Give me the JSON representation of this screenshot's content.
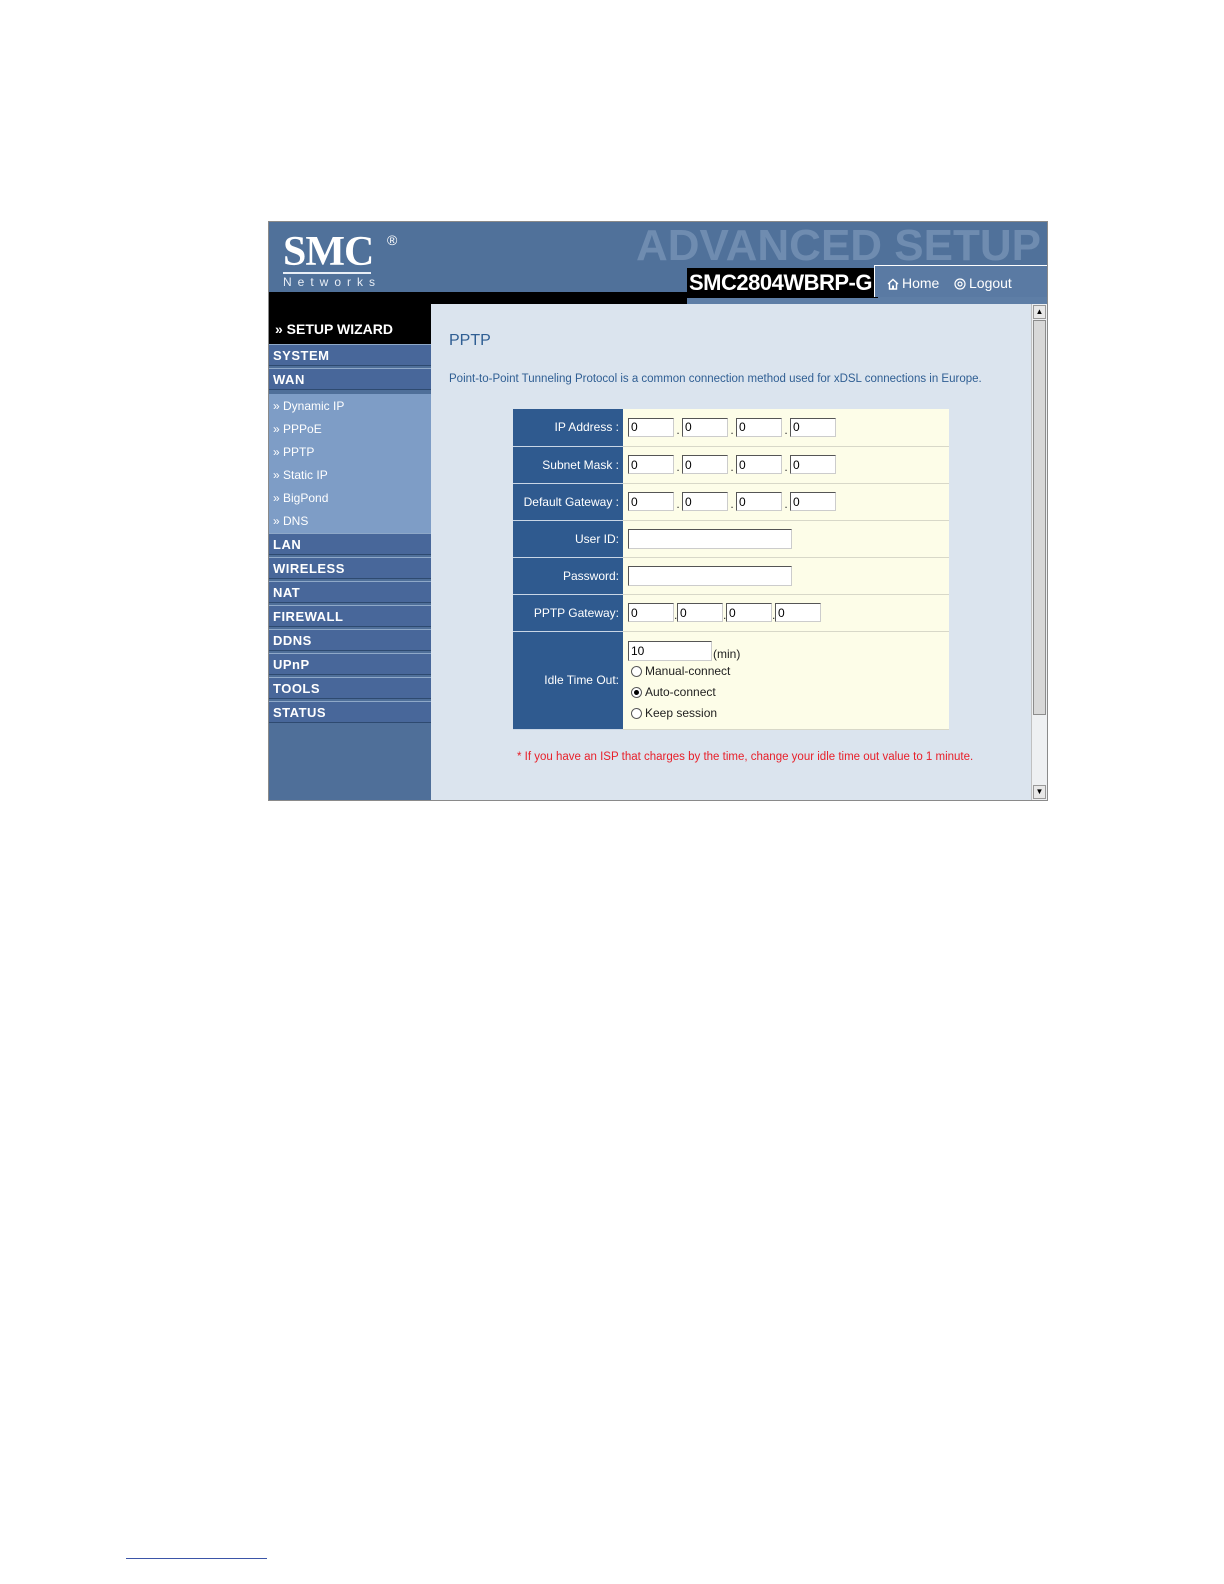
{
  "header": {
    "logo_text": "SMC",
    "logo_reg": "®",
    "logo_sub": "Networks",
    "banner": "ADVANCED SETUP",
    "model": "SMC2804WBRP-G",
    "home_label": "Home",
    "logout_label": "Logout"
  },
  "sidebar": {
    "wizard_label": "» SETUP WIZARD",
    "items": [
      {
        "label": "SYSTEM"
      },
      {
        "label": "WAN"
      },
      {
        "label": "LAN"
      },
      {
        "label": "WIRELESS"
      },
      {
        "label": "NAT"
      },
      {
        "label": "FIREWALL"
      },
      {
        "label": "DDNS"
      },
      {
        "label": "UPnP"
      },
      {
        "label": "TOOLS"
      },
      {
        "label": "STATUS"
      }
    ],
    "wan_sub": [
      {
        "label": "» Dynamic IP"
      },
      {
        "label": "» PPPoE"
      },
      {
        "label": "» PPTP"
      },
      {
        "label": "» Static IP"
      },
      {
        "label": "» BigPond"
      },
      {
        "label": "» DNS"
      }
    ]
  },
  "main": {
    "title": "PPTP",
    "description": "Point-to-Point Tunneling Protocol is a common connection method used for xDSL connections in Europe.",
    "form": {
      "ip_label": "IP Address :",
      "ip": [
        "0",
        "0",
        "0",
        "0"
      ],
      "mask_label": "Subnet Mask :",
      "mask": [
        "0",
        "0",
        "0",
        "0"
      ],
      "gw_label": "Default Gateway :",
      "gw": [
        "0",
        "0",
        "0",
        "0"
      ],
      "user_label": "User ID:",
      "user_value": "",
      "pass_label": "Password:",
      "pass_value": "",
      "pptp_gw_label": "PPTP Gateway:",
      "pptp_gw": [
        "0",
        "0",
        "0",
        "0"
      ],
      "idle_label": "Idle Time Out:",
      "idle_value": "10",
      "idle_unit": "(min)",
      "options": [
        {
          "label": "Manual-connect",
          "checked": false
        },
        {
          "label": "Auto-connect",
          "checked": true
        },
        {
          "label": "Keep session",
          "checked": false
        }
      ]
    },
    "note": "* If you have an ISP that charges by the time, change your idle time out value to 1 minute."
  },
  "colors": {
    "header_bg": "#50719a",
    "label_bg": "#2f5a8f",
    "field_bg": "#fdfde8",
    "content_bg": "#dbe4ee",
    "note_color": "#e8202a"
  }
}
